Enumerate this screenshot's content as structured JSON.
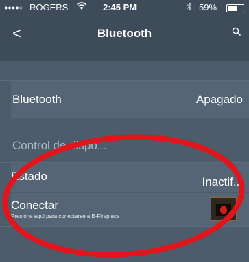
{
  "status_bar": {
    "signal": "●●●●○",
    "carrier": "ROGERS",
    "wifi_icon": "wifi-icon",
    "time": "2:45 PM",
    "bluetooth_icon": "bluetooth-icon",
    "battery": "59%",
    "battery_level": 0.59
  },
  "nav": {
    "back_label": "<",
    "title": "Bluetooth",
    "search_icon": "search-icon"
  },
  "settings": {
    "bluetooth": {
      "label": "Bluetooth",
      "value": "Apagado"
    },
    "section_header": "Control de dispo...",
    "estado": {
      "label": "Estado",
      "value": "Inactif..."
    },
    "conectar": {
      "label": "Conectar",
      "sub": "Presione aqui para conectarse a E-Fireplace",
      "icon": "fireplace-icon"
    }
  },
  "colors": {
    "background": "#4d5c6b",
    "bar": "#3e4c5a",
    "cell": "#566575",
    "annotation": "#e0161c"
  }
}
